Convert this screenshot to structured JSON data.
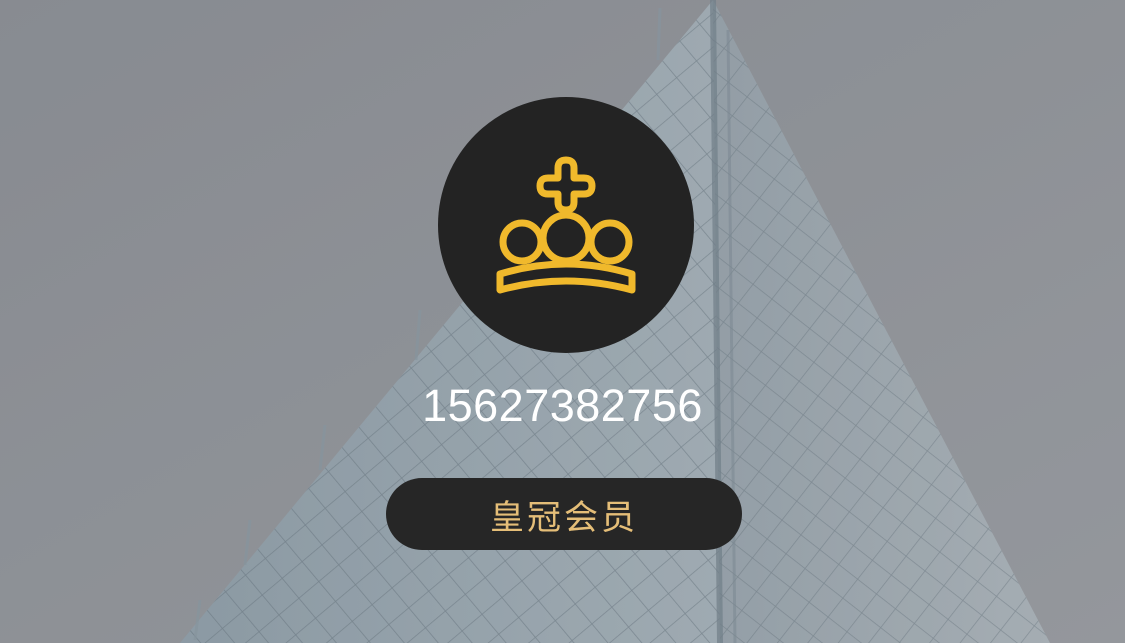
{
  "profile": {
    "phone": "15627382756",
    "membership_label": "皇冠会员",
    "avatar_icon": "crown-icon"
  },
  "colors": {
    "gold": "#F0B92C",
    "badge_text": "#E5BE78",
    "avatar_bg": "#232323",
    "badge_bg": "#262626",
    "background": "#8E9298"
  }
}
